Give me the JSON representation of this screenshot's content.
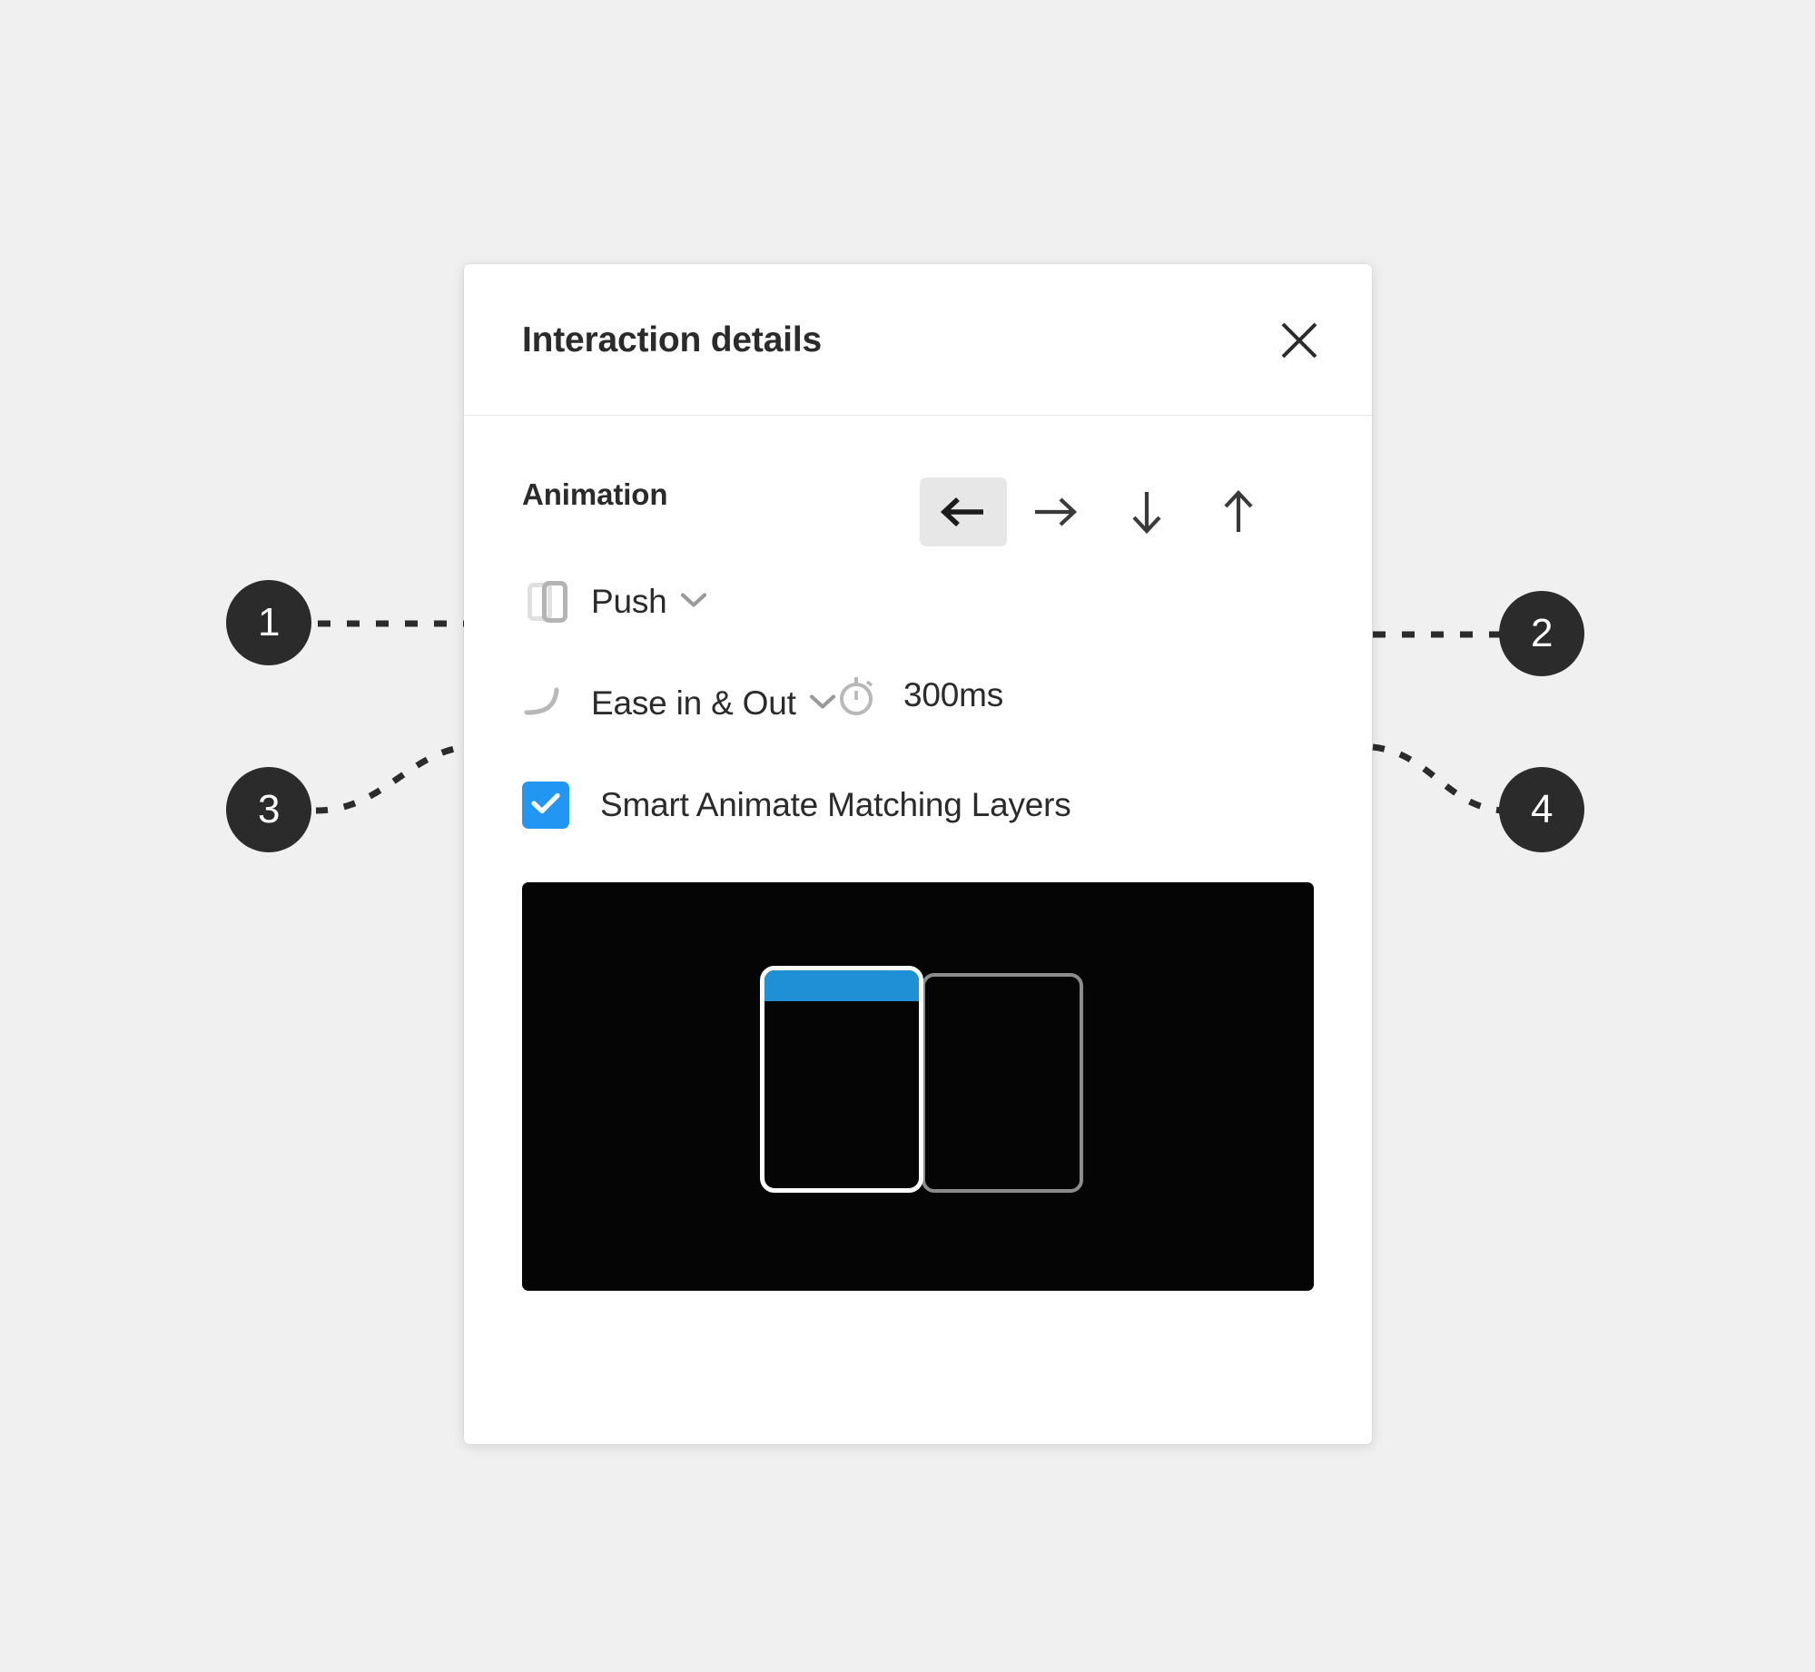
{
  "panel": {
    "title": "Interaction details",
    "close_icon": "close-icon",
    "section_heading": "Animation",
    "transition": {
      "icon": "push-panels-icon",
      "value": "Push",
      "chevron_icon": "chevron-down-icon"
    },
    "direction": {
      "selected": "left",
      "options": [
        {
          "key": "left",
          "icon": "arrow-left-icon",
          "glyph": "←",
          "selected": true
        },
        {
          "key": "right",
          "icon": "arrow-right-icon",
          "glyph": "→",
          "selected": false
        },
        {
          "key": "down",
          "icon": "arrow-down-icon",
          "glyph": "↓",
          "selected": false
        },
        {
          "key": "up",
          "icon": "arrow-up-icon",
          "glyph": "↑",
          "selected": false
        }
      ]
    },
    "easing": {
      "icon": "ease-curve-icon",
      "value": "Ease in & Out",
      "chevron_icon": "chevron-down-icon"
    },
    "duration": {
      "icon": "stopwatch-icon",
      "value": "300ms"
    },
    "smart_animate": {
      "label": "Smart Animate Matching Layers",
      "checked": true,
      "checkbox_icon": "checkmark-icon"
    },
    "preview": {
      "background_color": "#050505",
      "incoming_frame_border_color": "#ffffff",
      "incoming_frame_bar_color": "#1f8fd6",
      "outgoing_frame_border_color": "#8c8c8c"
    }
  },
  "callouts": [
    {
      "number": "1",
      "target": "transition-type"
    },
    {
      "number": "2",
      "target": "direction-arrows"
    },
    {
      "number": "3",
      "target": "easing-curve"
    },
    {
      "number": "4",
      "target": "duration"
    }
  ],
  "colors": {
    "page_background": "#f0f0f0",
    "panel_background": "#ffffff",
    "accent_blue": "#2196f3",
    "badge_background": "#2b2b2b",
    "text_primary": "#2b2b2b",
    "selected_button_background": "#e7e7e7"
  }
}
